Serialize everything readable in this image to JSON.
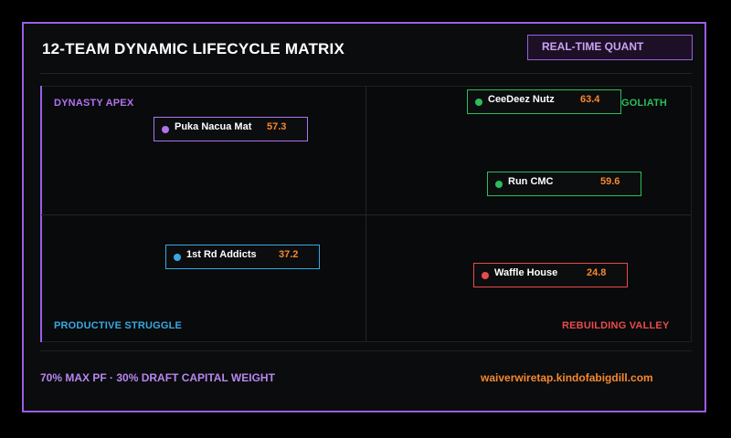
{
  "header": {
    "title": "12-TEAM DYNAMIC LIFECYCLE MATRIX",
    "badge": "REAL-TIME QUANT"
  },
  "quadrants": {
    "top_left": {
      "label": "DYNASTY APEX",
      "color": "#b173ee"
    },
    "top_right": {
      "label": "GOLIATH",
      "color": "#2dbd5a"
    },
    "bottom_left": {
      "label": "PRODUCTIVE STRUGGLE",
      "color": "#3aa8e0"
    },
    "bottom_right": {
      "label": "REBUILDING VALLEY",
      "color": "#e94b4b"
    }
  },
  "teams": [
    {
      "name": "CeeDeez Nutz",
      "score": "63.4",
      "quadrant": "GOLIATH",
      "color": "#2dbd5a"
    },
    {
      "name": "Puka Nacua Mat",
      "score": "57.3",
      "quadrant": "DYNASTY APEX",
      "color": "#b173ee"
    },
    {
      "name": "Run CMC",
      "score": "59.6",
      "quadrant": "GOLIATH",
      "color": "#2dbd5a"
    },
    {
      "name": "1st Rd Addicts",
      "score": "37.2",
      "quadrant": "PRODUCTIVE STRUGGLE",
      "color": "#3aa8e0"
    },
    {
      "name": "Waffle House",
      "score": "24.8",
      "quadrant": "REBUILDING VALLEY",
      "color": "#e94b4b"
    }
  ],
  "footer": {
    "weighting": "70% MAX PF · 30% DRAFT CAPITAL WEIGHT",
    "site": "waiverwiretap.kindofabigdill.com"
  }
}
